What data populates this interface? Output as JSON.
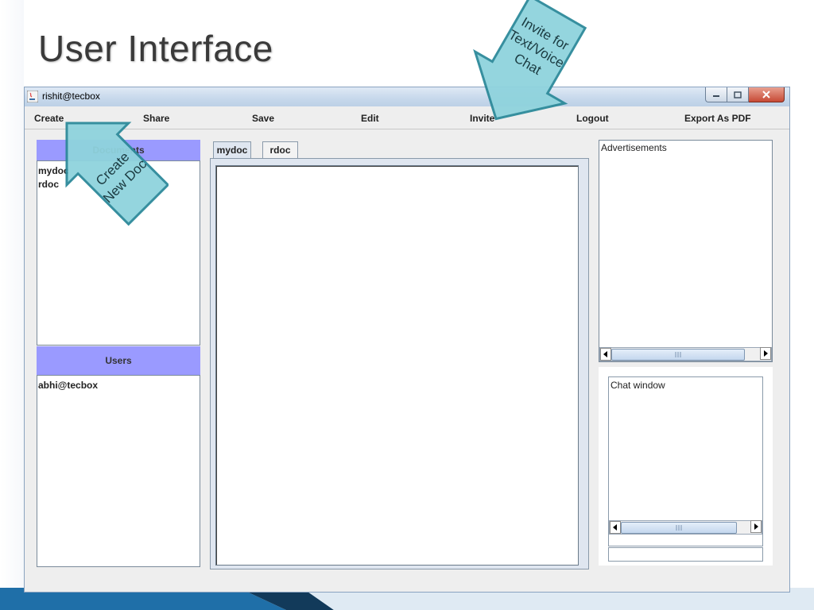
{
  "slide": {
    "title": "User Interface",
    "callouts": [
      {
        "name": "create-callout",
        "text_lines": [
          "Create",
          "New Doc"
        ]
      },
      {
        "name": "invite-callout",
        "text_lines": [
          "Invite for",
          "Text/Voice",
          "Chat"
        ]
      }
    ]
  },
  "window": {
    "title": "rishit@tecbox",
    "buttons": {
      "minimize": "minimize-icon",
      "maximize": "maximize-icon",
      "close": "close-icon"
    }
  },
  "menu": {
    "items": [
      "Create",
      "Share",
      "Save",
      "Edit",
      "Invite",
      "Logout",
      "Export As PDF"
    ]
  },
  "documents": {
    "header": "Documents",
    "items": [
      "mydoc",
      "rdoc"
    ]
  },
  "users": {
    "header": "Users",
    "items": [
      "abhi@tecbox"
    ]
  },
  "editor": {
    "tabs": [
      "mydoc",
      "rdoc"
    ],
    "active_tab": "mydoc"
  },
  "ads": {
    "label": "Advertisements"
  },
  "chat": {
    "label": "Chat window",
    "input_value": ""
  },
  "colors": {
    "panel_header": "#9a9aff",
    "callout_fill": "#8fd3dd",
    "callout_stroke": "#2d8a9a"
  }
}
